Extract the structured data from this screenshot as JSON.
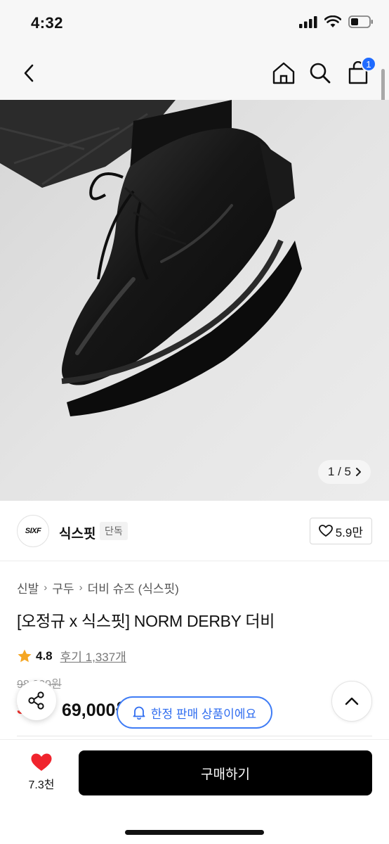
{
  "status_bar": {
    "time": "4:32"
  },
  "nav": {
    "cart_count": "1"
  },
  "gallery": {
    "counter": "1 / 5"
  },
  "brand": {
    "logo_text": "SIXF",
    "name": "식스핏",
    "tag": "단독",
    "likes": "5.9만"
  },
  "breadcrumb": [
    "신발",
    "구두",
    "더비 슈즈 (식스핏)"
  ],
  "product": {
    "title": "[오정규 x 식스핏] NORM DERBY 더비",
    "rating": "4.8",
    "review_text": "후기 1,337개",
    "original_price": "98,000원",
    "discount": "30%",
    "sale_price": "69,000원"
  },
  "limited_notice": "한정 판매 상품이에요",
  "bottom_bar": {
    "wish_count": "7.3천",
    "buy_label": "구매하기"
  },
  "colors": {
    "accent_blue": "#2f6df0",
    "badge_blue": "#1f6bff",
    "sale_red": "#f2302c",
    "star": "#f5a623",
    "heart": "#f0242d"
  }
}
